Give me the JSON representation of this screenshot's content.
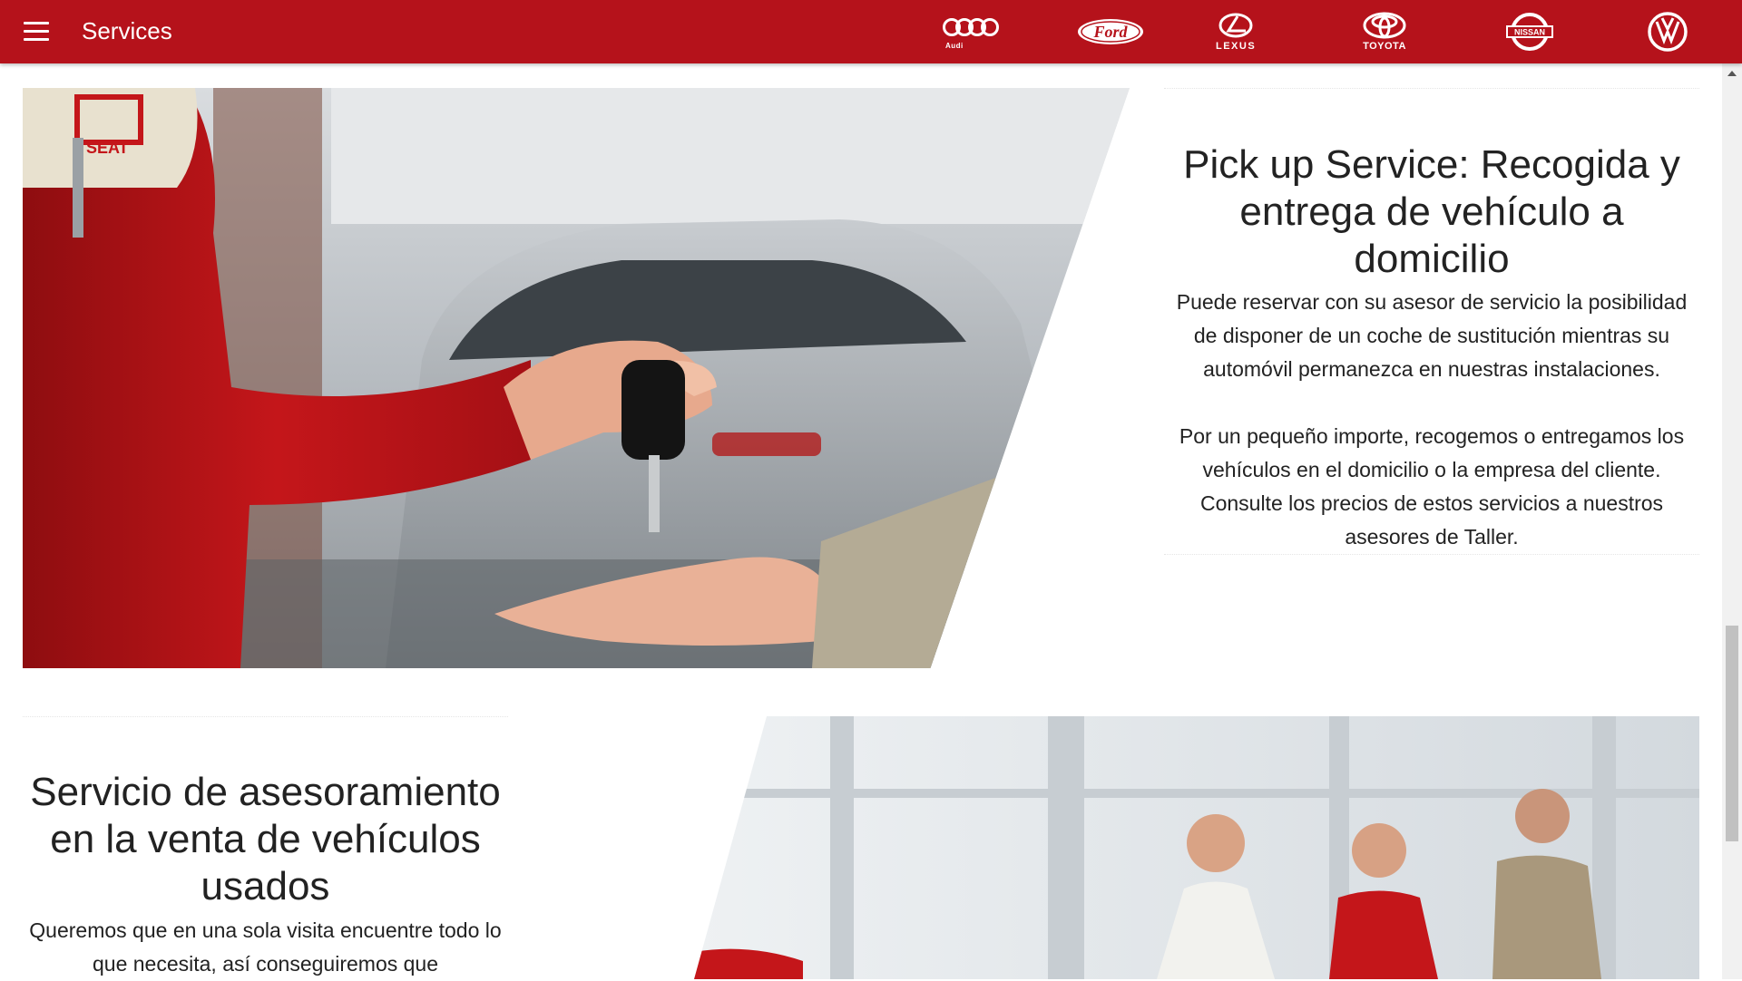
{
  "appbar": {
    "title": "Services",
    "brands": [
      {
        "name": "audi-logo",
        "label": "Audi"
      },
      {
        "name": "ford-logo",
        "label": "Ford"
      },
      {
        "name": "lexus-logo",
        "label": "LEXUS"
      },
      {
        "name": "toyota-logo",
        "label": "TOYOTA"
      },
      {
        "name": "nissan-logo",
        "label": "NISSAN"
      },
      {
        "name": "volkswagen-logo",
        "label": "VW"
      }
    ],
    "color": "#b5121b"
  },
  "sections": [
    {
      "title": "Pick up Service: Recogida y entrega de vehículo a domicilio",
      "paragraphs": [
        "Puede reservar con su asesor de servicio la posibilidad de disponer de un coche de sustitución mientras su automóvil permanezca en nuestras instalaciones.",
        "Por un pequeño importe, recogemos o entregamos los vehículos en el domicilio o la empresa del cliente. Consulte los precios de estos servicios a nuestros asesores de Taller."
      ],
      "image": "key-handover-photo",
      "badge_text": "SEAT"
    },
    {
      "title": "Servicio de asesoramiento en la venta de vehículos usados",
      "paragraphs": [
        "Queremos que en una sola visita encuentre todo lo que necesita, así conseguiremos que"
      ],
      "image": "sales-advisors-photo"
    }
  ]
}
